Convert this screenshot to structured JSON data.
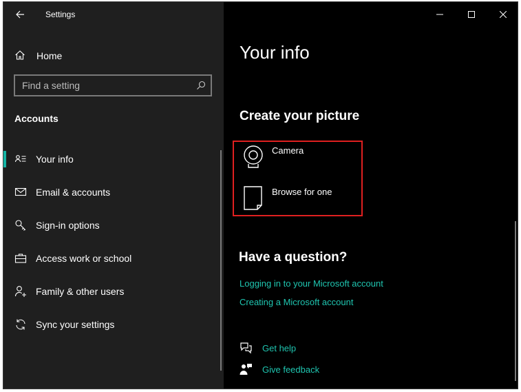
{
  "app": {
    "title": "Settings"
  },
  "sidebar": {
    "home_label": "Home",
    "search_placeholder": "Find a setting",
    "section_title": "Accounts",
    "items": [
      {
        "label": "Your info",
        "icon": "person-card-icon",
        "selected": true
      },
      {
        "label": "Email & accounts",
        "icon": "mail-icon",
        "selected": false
      },
      {
        "label": "Sign-in options",
        "icon": "key-icon",
        "selected": false
      },
      {
        "label": "Access work or school",
        "icon": "briefcase-icon",
        "selected": false
      },
      {
        "label": "Family & other users",
        "icon": "person-add-icon",
        "selected": false
      },
      {
        "label": "Sync your settings",
        "icon": "sync-icon",
        "selected": false
      }
    ]
  },
  "main": {
    "title": "Your info",
    "create_picture": {
      "heading": "Create your picture",
      "options": [
        {
          "label": "Camera",
          "icon": "camera-icon"
        },
        {
          "label": "Browse for one",
          "icon": "file-icon"
        }
      ]
    },
    "question": {
      "heading": "Have a question?",
      "links": [
        "Logging in to your Microsoft account",
        "Creating a Microsoft account"
      ]
    },
    "help": {
      "get_help": "Get help",
      "give_feedback": "Give feedback"
    }
  },
  "colors": {
    "accent": "#1fc5b0",
    "selection_indicator": "#14b5a5",
    "highlight_border": "#e02020",
    "sidebar_bg": "#1f1f1f",
    "content_bg": "#000000"
  }
}
